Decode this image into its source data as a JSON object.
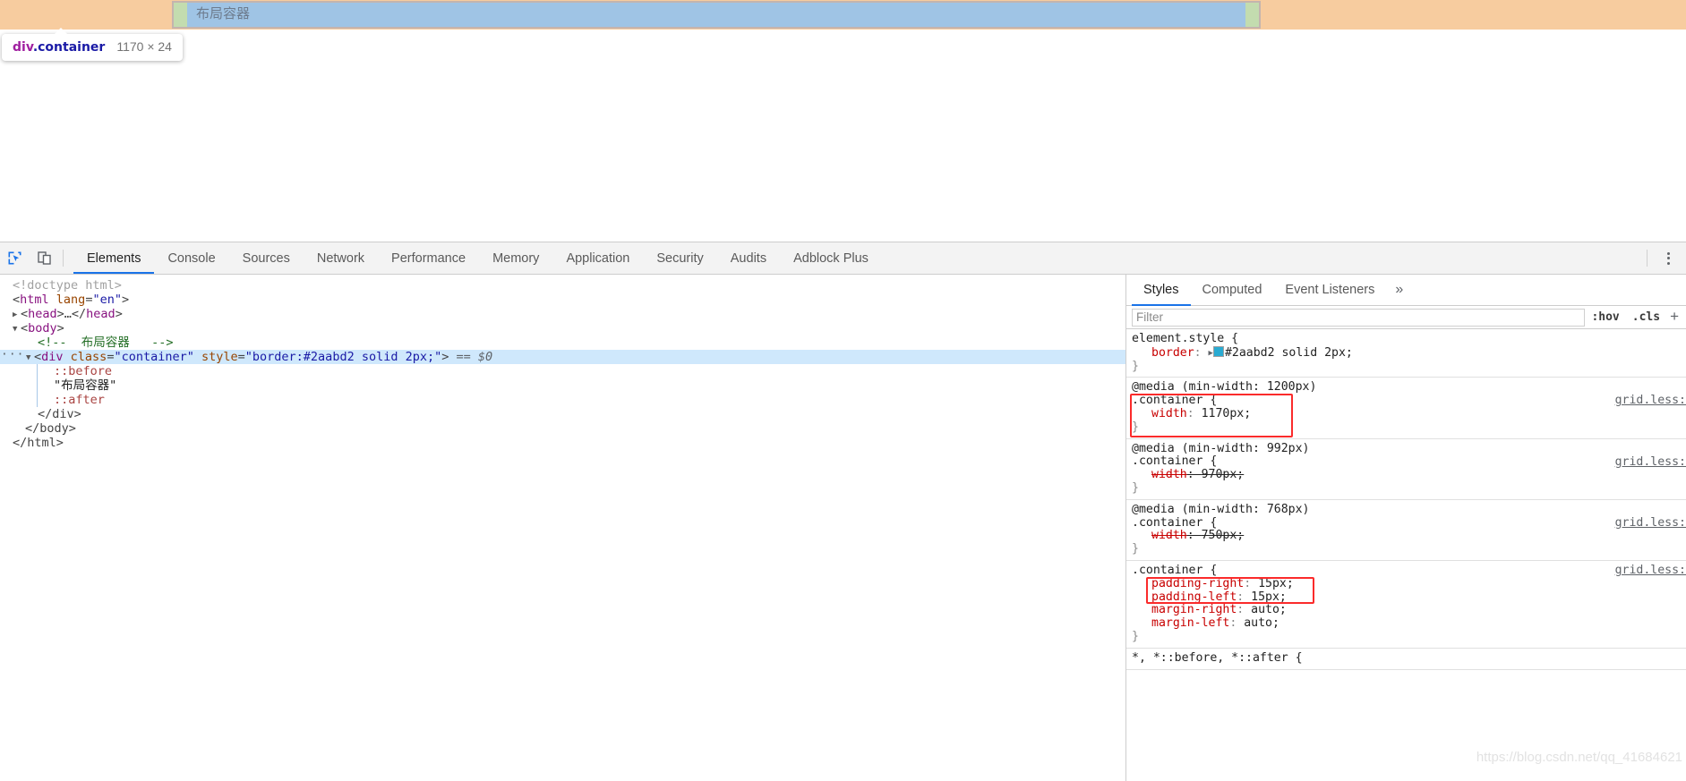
{
  "highlight": {
    "label_text": "布局容器",
    "tooltip": {
      "tag": "div",
      "class_name": ".container",
      "dimensions": "1170 × 24"
    },
    "colors": {
      "margin": "#f7cc9f",
      "border": "#c4b4ae",
      "padding": "#c3dcaf",
      "content": "#9fc4e5"
    }
  },
  "toolbar": {
    "inspect_icon": "inspect-element-icon",
    "device_icon": "device-toolbar-icon",
    "tabs": [
      {
        "label": "Elements",
        "active": true
      },
      {
        "label": "Console",
        "active": false
      },
      {
        "label": "Sources",
        "active": false
      },
      {
        "label": "Network",
        "active": false
      },
      {
        "label": "Performance",
        "active": false
      },
      {
        "label": "Memory",
        "active": false
      },
      {
        "label": "Application",
        "active": false
      },
      {
        "label": "Security",
        "active": false
      },
      {
        "label": "Audits",
        "active": false
      },
      {
        "label": "Adblock Plus",
        "active": false
      }
    ],
    "menu_icon": "kebab-menu-icon"
  },
  "dom": {
    "lines": [
      {
        "id": "l0",
        "text": "<!doctype html>"
      },
      {
        "id": "l1",
        "text": "<html lang=\"en\">"
      },
      {
        "id": "l2",
        "text": "<head>…</head>"
      },
      {
        "id": "l3",
        "text": "<body>"
      },
      {
        "id": "l4",
        "text": "<!-- 布局容器  -->"
      },
      {
        "id": "l5",
        "text": "<div class=\"container\" style=\"border:#2aabd2 solid 2px;\"> == $0"
      },
      {
        "id": "l6",
        "text": "::before"
      },
      {
        "id": "l7",
        "text": "\"布局容器\""
      },
      {
        "id": "l8",
        "text": "::after"
      },
      {
        "id": "l9",
        "text": "</div>"
      },
      {
        "id": "l10",
        "text": "</body>"
      },
      {
        "id": "l11",
        "text": "</html>"
      }
    ],
    "parts": {
      "doctype": "<!doctype html>",
      "html_open_tag": "html",
      "html_attr_name": "lang",
      "html_attr_value": "\"en\"",
      "head_tag": "head",
      "body_tag": "body",
      "comment": "<!--  布局容器   -->",
      "div_tag": "div",
      "div_attr_class": "class",
      "div_class_value": "\"container\"",
      "div_attr_style": "style",
      "div_style_value": "\"border:#2aabd2 solid 2px;\"",
      "selected_marker": "== $0",
      "before_pseudo": "::before",
      "text_node": "\"布局容器\"",
      "after_pseudo": "::after",
      "div_close": "</div>",
      "body_close": "</body>",
      "html_close": "</html>"
    }
  },
  "styles": {
    "tabs": [
      {
        "label": "Styles",
        "active": true
      },
      {
        "label": "Computed",
        "active": false
      },
      {
        "label": "Event Listeners",
        "active": false
      }
    ],
    "more_icon": "chevron-double-right-icon",
    "filter": {
      "value": "",
      "placeholder": "Filter"
    },
    "hov_button": ":hov",
    "cls_button": ".cls",
    "add_button": "+",
    "rules": [
      {
        "id": "r0",
        "media": null,
        "selector": "element.style {",
        "source": null,
        "declarations": [
          {
            "property": "border",
            "value": "#2aabd2 solid 2px;",
            "swatch": "#2aabd2",
            "has_expander": true,
            "struck": false,
            "highlighted": false
          }
        ],
        "close": "}"
      },
      {
        "id": "r1",
        "media": "@media (min-width: 1200px)",
        "selector": ".container {",
        "source": "grid.less:",
        "declarations": [
          {
            "property": "width",
            "value": "1170px;",
            "struck": false,
            "highlighted": true
          }
        ],
        "close": "}"
      },
      {
        "id": "r2",
        "media": "@media (min-width: 992px)",
        "selector": ".container {",
        "source": "grid.less:",
        "declarations": [
          {
            "property": "width",
            "value": "970px;",
            "struck": true,
            "highlighted": false
          }
        ],
        "close": "}"
      },
      {
        "id": "r3",
        "media": "@media (min-width: 768px)",
        "selector": ".container {",
        "source": "grid.less:",
        "declarations": [
          {
            "property": "width",
            "value": "750px;",
            "struck": true,
            "highlighted": false
          }
        ],
        "close": "}"
      },
      {
        "id": "r4",
        "media": null,
        "selector": ".container {",
        "source": "grid.less:",
        "declarations": [
          {
            "property": "padding-right",
            "value": "15px;",
            "struck": false,
            "highlighted": true
          },
          {
            "property": "padding-left",
            "value": "15px;",
            "struck": false,
            "highlighted": true
          },
          {
            "property": "margin-right",
            "value": "auto;",
            "struck": false,
            "highlighted": false
          },
          {
            "property": "margin-left",
            "value": "auto;",
            "struck": false,
            "highlighted": false
          }
        ],
        "close": "}"
      }
    ],
    "watermark": "https://blog.csdn.net/qq_41684621"
  }
}
